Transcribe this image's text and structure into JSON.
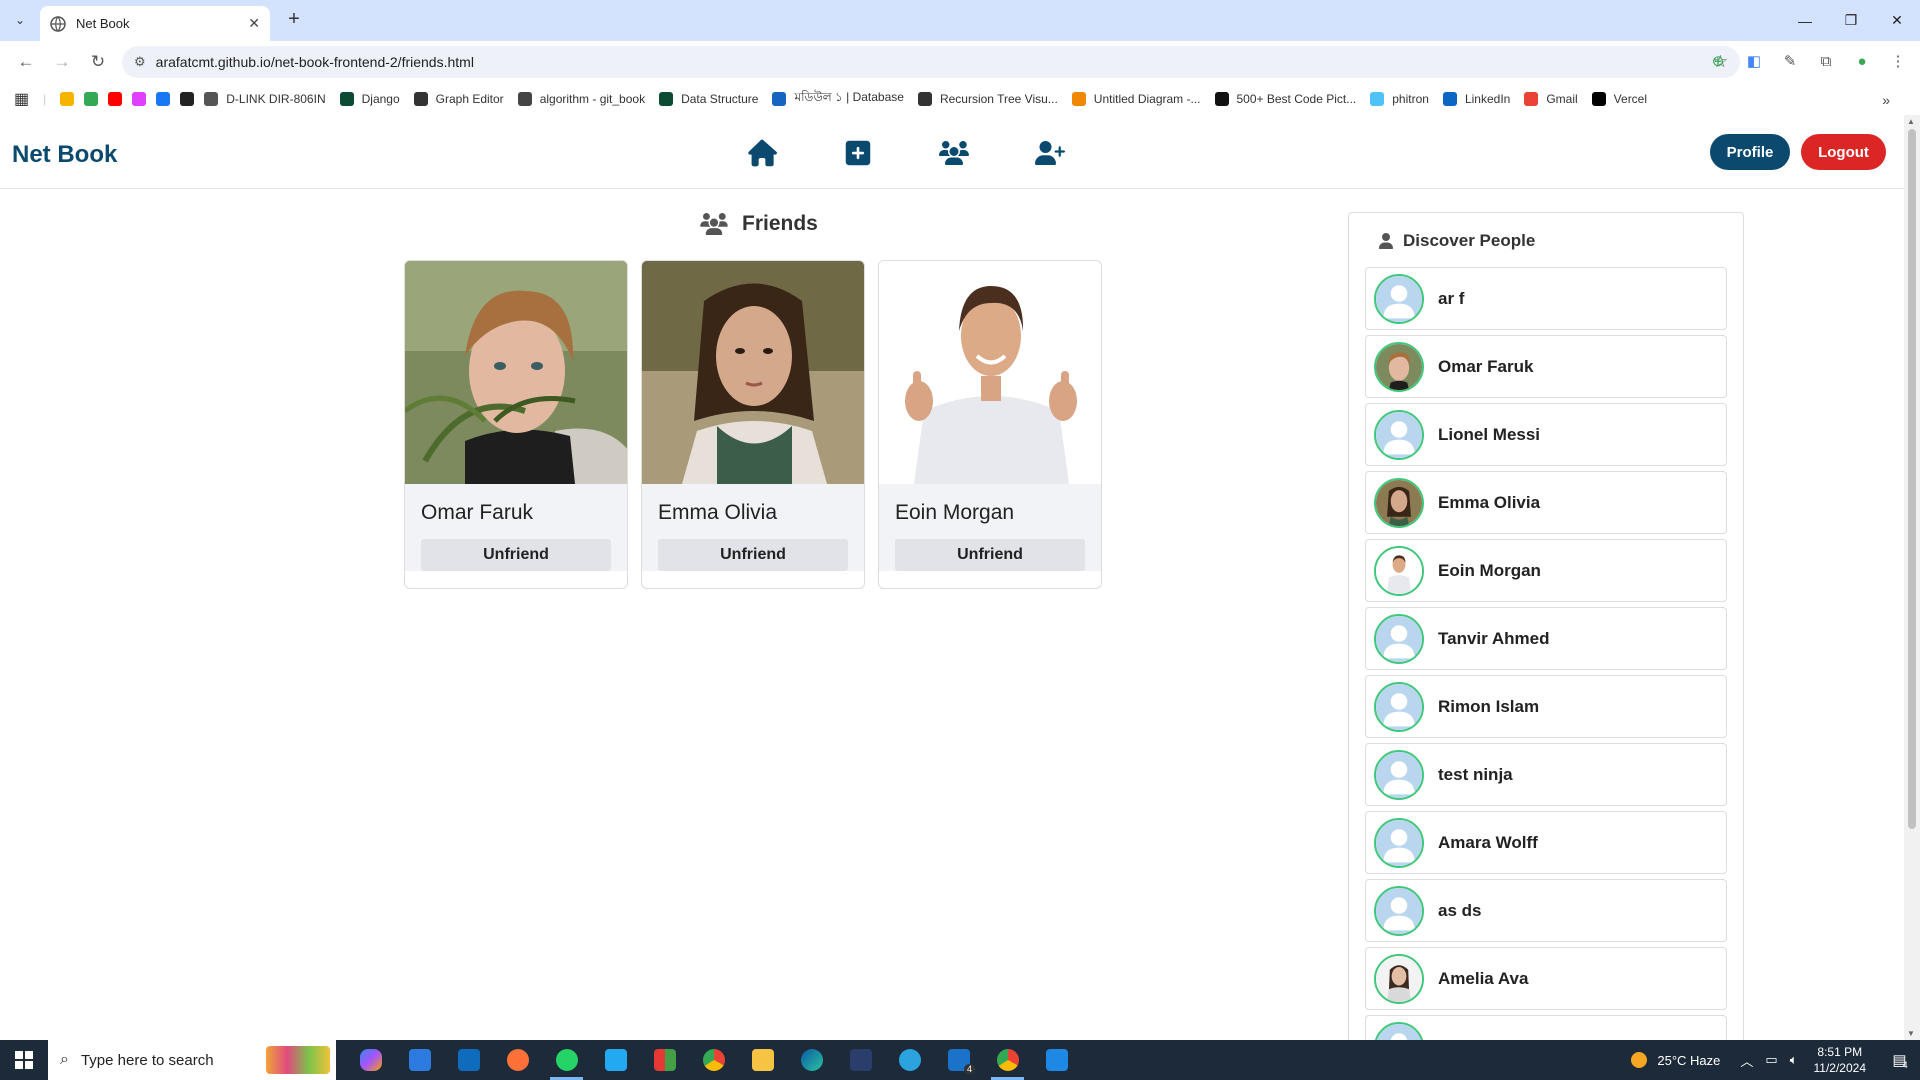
{
  "browser": {
    "tab_title": "Net Book",
    "url": "arafatcmt.github.io/net-book-frontend-2/friends.html",
    "bookmarks": [
      {
        "label": "",
        "color": "#f4b400",
        "icon": "drive-icon"
      },
      {
        "label": "",
        "color": "#34a853",
        "icon": "meet-icon"
      },
      {
        "label": "",
        "color": "#ff0000",
        "icon": "youtube-icon"
      },
      {
        "label": "",
        "color": "#e040fb",
        "icon": "app-icon"
      },
      {
        "label": "",
        "color": "#1877f2",
        "icon": "facebook-icon"
      },
      {
        "label": "",
        "color": "#222222",
        "icon": "github-icon"
      },
      {
        "label": "D-LINK DIR-806IN",
        "color": "#555555",
        "icon": "globe-icon"
      },
      {
        "label": "Django",
        "color": "#0c4b33",
        "icon": "django-icon"
      },
      {
        "label": "Graph Editor",
        "color": "#333333",
        "icon": "graph-icon"
      },
      {
        "label": "algorithm - git_book",
        "color": "#444444",
        "icon": "book-icon"
      },
      {
        "label": "Data Structure",
        "color": "#0c4b33",
        "icon": "django-icon"
      },
      {
        "label": "মডিউল ১ | Database",
        "color": "#1565c0",
        "icon": "bookmark-icon"
      },
      {
        "label": "Recursion Tree Visu...",
        "color": "#333333",
        "icon": "tree-icon"
      },
      {
        "label": "Untitled Diagram -...",
        "color": "#f08705",
        "icon": "drawio-icon"
      },
      {
        "label": "500+ Best Code Pict...",
        "color": "#111111",
        "icon": "unsplash-icon"
      },
      {
        "label": "phitron",
        "color": "#4fc3f7",
        "icon": "phitron-icon"
      },
      {
        "label": "LinkedIn",
        "color": "#0a66c2",
        "icon": "linkedin-icon"
      },
      {
        "label": "Gmail",
        "color": "#ea4335",
        "icon": "gmail-icon"
      },
      {
        "label": "Vercel",
        "color": "#000000",
        "icon": "vercel-icon"
      }
    ]
  },
  "header": {
    "brand": "Net Book",
    "profile_label": "Profile",
    "logout_label": "Logout"
  },
  "friends": {
    "title": "Friends",
    "items": [
      {
        "name": "Omar Faruk",
        "action": "Unfriend"
      },
      {
        "name": "Emma Olivia",
        "action": "Unfriend"
      },
      {
        "name": "Eoin Morgan",
        "action": "Unfriend"
      }
    ]
  },
  "discover": {
    "title": "Discover People",
    "people": [
      {
        "name": "ar f",
        "avatar": "default"
      },
      {
        "name": "Omar Faruk",
        "avatar": "photo"
      },
      {
        "name": "Lionel Messi",
        "avatar": "default"
      },
      {
        "name": "Emma Olivia",
        "avatar": "photo"
      },
      {
        "name": "Eoin Morgan",
        "avatar": "photo"
      },
      {
        "name": "Tanvir Ahmed",
        "avatar": "default"
      },
      {
        "name": "Rimon Islam",
        "avatar": "default"
      },
      {
        "name": "test ninja",
        "avatar": "default"
      },
      {
        "name": "Amara Wolff",
        "avatar": "default"
      },
      {
        "name": "as ds",
        "avatar": "default"
      },
      {
        "name": "Amelia Ava",
        "avatar": "photo"
      }
    ]
  },
  "taskbar": {
    "search_placeholder": "Type here to search",
    "weather": "25°C  Haze",
    "time": "8:51 PM",
    "date": "11/2/2024",
    "mail_badge": "4",
    "notif_badge": "4"
  },
  "colors": {
    "brand": "#0b4a6e",
    "logout": "#dc2626",
    "avatar_ring": "#3fc77a"
  }
}
